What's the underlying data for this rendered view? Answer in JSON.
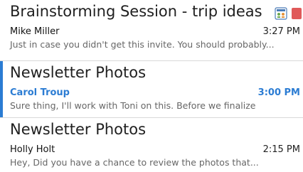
{
  "messages": [
    {
      "subject": "Brainstorming Session - trip ideas",
      "sender": "Mike Miller",
      "time": "3:27 PM",
      "preview": "Just in case you didn't get this invite. You should probably...",
      "icons": [
        "meeting-icon",
        "flag-icon"
      ]
    },
    {
      "subject": "Newsletter Photos",
      "sender": "Carol Troup",
      "time": "3:00 PM",
      "preview": "Sure thing, I'll work with Toni on this. Before we finalize",
      "unread": true
    },
    {
      "subject": "Newsletter Photos",
      "sender": "Holly Holt",
      "time": "2:15 PM",
      "preview": "Hey, Did you have a chance to review the photos that..."
    }
  ],
  "colors": {
    "accent": "#2b7cd3",
    "flag": "#e05a5a"
  }
}
